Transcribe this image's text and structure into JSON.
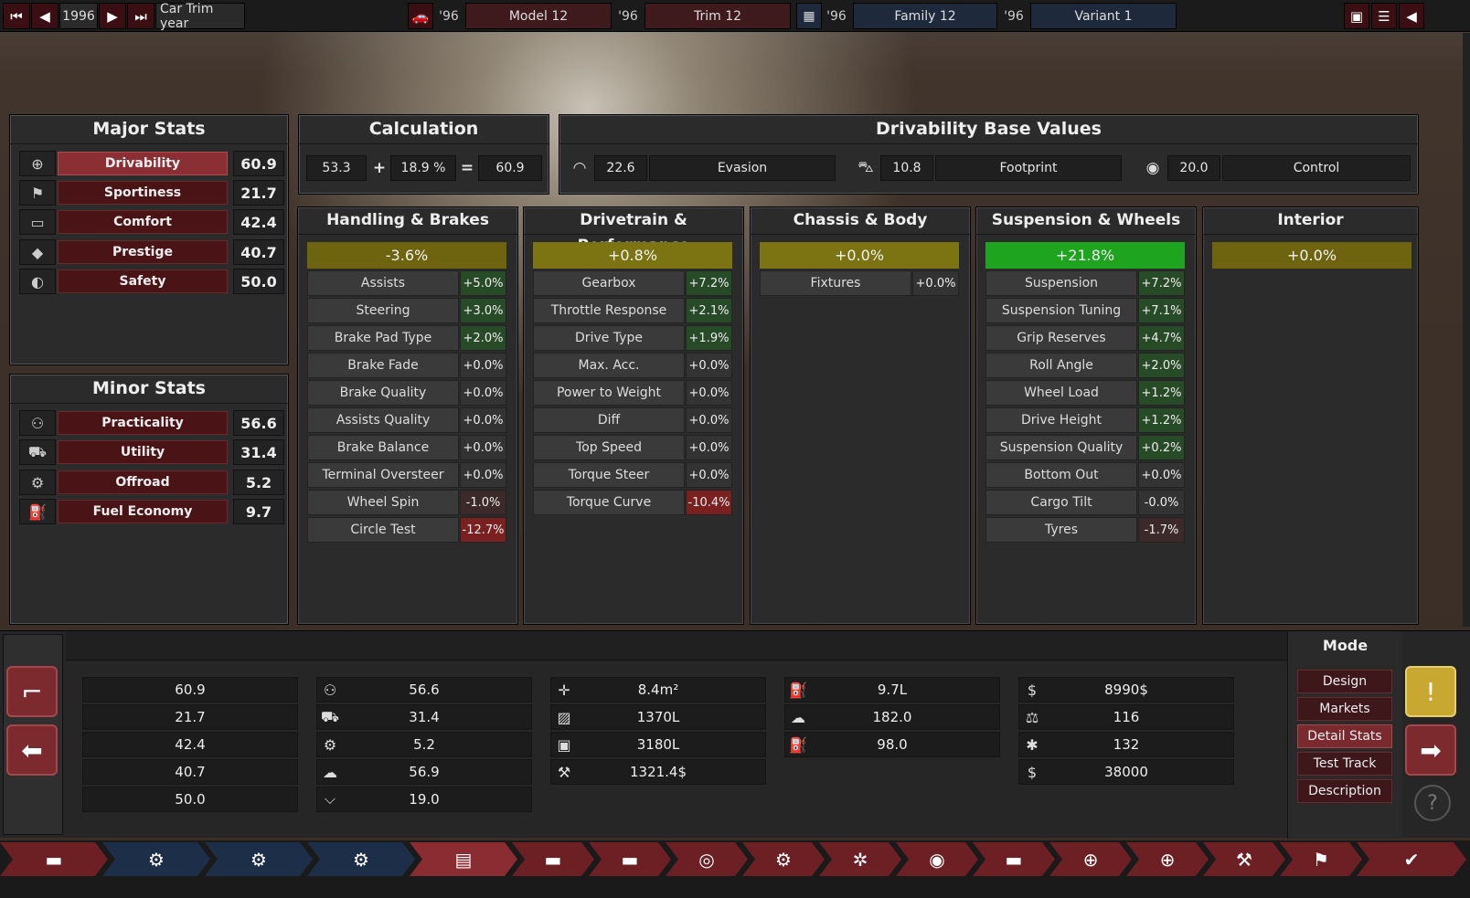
{
  "topbar": {
    "year": "1996",
    "label": "Car Trim year",
    "model_year": "'96",
    "model": "Model 12",
    "trim_year": "'96",
    "trim": "Trim 12",
    "family_year": "'96",
    "family": "Family 12",
    "variant_year": "'96",
    "variant": "Variant 1"
  },
  "major": {
    "title": "Major Stats",
    "items": [
      {
        "label": "Drivability",
        "value": "60.9",
        "icon": "steering-wheel-icon"
      },
      {
        "label": "Sportiness",
        "value": "21.7",
        "icon": "checkered-flag-icon"
      },
      {
        "label": "Comfort",
        "value": "42.4",
        "icon": "seat-icon"
      },
      {
        "label": "Prestige",
        "value": "40.7",
        "icon": "diamond-icon"
      },
      {
        "label": "Safety",
        "value": "50.0",
        "icon": "crash-test-icon"
      }
    ]
  },
  "minor": {
    "title": "Minor Stats",
    "items": [
      {
        "label": "Practicality",
        "value": "56.6",
        "icon": "passengers-icon"
      },
      {
        "label": "Utility",
        "value": "31.4",
        "icon": "truck-icon"
      },
      {
        "label": "Offroad",
        "value": "5.2",
        "icon": "offroad-car-icon"
      },
      {
        "label": "Fuel Economy",
        "value": "9.7",
        "icon": "fuel-can-icon"
      }
    ]
  },
  "calc": {
    "title": "Calculation",
    "base": "53.3",
    "plus": "+",
    "percent": "18.9 %",
    "equals": "=",
    "result": "60.9"
  },
  "dbv": {
    "title": "Drivability Base Values",
    "items": [
      {
        "value": "22.6",
        "name": "Evasion",
        "icon": "evasion-icon"
      },
      {
        "value": "10.8",
        "name": "Footprint",
        "icon": "car-front-icon"
      },
      {
        "value": "20.0",
        "name": "Control",
        "icon": "control-icon"
      }
    ]
  },
  "columns": [
    {
      "title": "Handling & Brakes",
      "total": "-3.6%",
      "rows": [
        {
          "name": "Assists",
          "value": "+5.0%"
        },
        {
          "name": "Steering",
          "value": "+3.0%"
        },
        {
          "name": "Brake Pad Type",
          "value": "+2.0%"
        },
        {
          "name": "Brake Fade",
          "value": "+0.0%"
        },
        {
          "name": "Brake Quality",
          "value": "+0.0%"
        },
        {
          "name": "Assists Quality",
          "value": "+0.0%"
        },
        {
          "name": "Brake Balance",
          "value": "+0.0%"
        },
        {
          "name": "Terminal Oversteer",
          "value": "+0.0%"
        },
        {
          "name": "Wheel Spin",
          "value": "-1.0%"
        },
        {
          "name": "Circle Test",
          "value": "-12.7%"
        }
      ]
    },
    {
      "title": "Drivetrain & Performance",
      "total": "+0.8%",
      "rows": [
        {
          "name": "Gearbox",
          "value": "+7.2%"
        },
        {
          "name": "Throttle Response",
          "value": "+2.1%"
        },
        {
          "name": "Drive Type",
          "value": "+1.9%"
        },
        {
          "name": "Max. Acc.",
          "value": "+0.0%"
        },
        {
          "name": "Power to Weight",
          "value": "+0.0%"
        },
        {
          "name": "Diff",
          "value": "+0.0%"
        },
        {
          "name": "Top Speed",
          "value": "+0.0%"
        },
        {
          "name": "Torque Steer",
          "value": "+0.0%"
        },
        {
          "name": "Torque Curve",
          "value": "-10.4%"
        }
      ]
    },
    {
      "title": "Chassis & Body",
      "total": "+0.0%",
      "rows": [
        {
          "name": "Fixtures",
          "value": "+0.0%"
        }
      ]
    },
    {
      "title": "Suspension & Wheels",
      "total": "+21.8%",
      "rows": [
        {
          "name": "Suspension",
          "value": "+7.2%"
        },
        {
          "name": "Suspension Tuning",
          "value": "+7.1%"
        },
        {
          "name": "Grip Reserves",
          "value": "+4.7%"
        },
        {
          "name": "Roll Angle",
          "value": "+2.0%"
        },
        {
          "name": "Wheel Load",
          "value": "+1.2%"
        },
        {
          "name": "Drive Height",
          "value": "+1.2%"
        },
        {
          "name": "Suspension Quality",
          "value": "+0.2%"
        },
        {
          "name": "Bottom Out",
          "value": "+0.0%"
        },
        {
          "name": "Cargo Tilt",
          "value": "-0.0%"
        },
        {
          "name": "Tyres",
          "value": "-1.7%"
        }
      ]
    },
    {
      "title": "Interior",
      "total": "+0.0%",
      "rows": []
    }
  ],
  "summary": {
    "col1": [
      "60.9",
      "21.7",
      "42.4",
      "40.7",
      "50.0"
    ],
    "col2": [
      "56.6",
      "31.4",
      "5.2",
      "56.9",
      "19.0"
    ],
    "col3": [
      "8.4m²",
      "1370L",
      "3180L",
      "1321.4$"
    ],
    "col4": [
      "9.7L",
      "182.0",
      "98.0"
    ],
    "col5": [
      "8990$",
      "116",
      "132",
      "38000"
    ]
  },
  "mode": {
    "title": "Mode",
    "buttons": [
      "Design",
      "Markets",
      "Detail Stats",
      "Test Track",
      "Description"
    ]
  },
  "colors": {
    "accent_red": "#8a2f34",
    "olive": "#6e6410",
    "green": "#1ea41e",
    "negative": "#7a2020",
    "nav_blue": "#1d2f48"
  }
}
